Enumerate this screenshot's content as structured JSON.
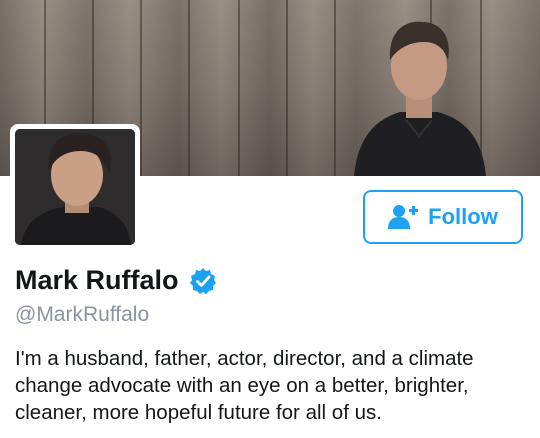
{
  "profile": {
    "display_name": "Mark Ruffalo",
    "handle": "@MarkRuffalo",
    "verified": true,
    "bio": "I'm a husband, father, actor, director, and a climate change advocate with an eye on a better, brighter, cleaner, more hopeful future for all of us."
  },
  "actions": {
    "follow_label": "Follow",
    "follow_icon": "add-user-icon"
  },
  "colors": {
    "accent": "#1da1f2",
    "name_text": "#14171a",
    "handle_text": "#8a949e",
    "verified_badge": "#1da1f2"
  }
}
